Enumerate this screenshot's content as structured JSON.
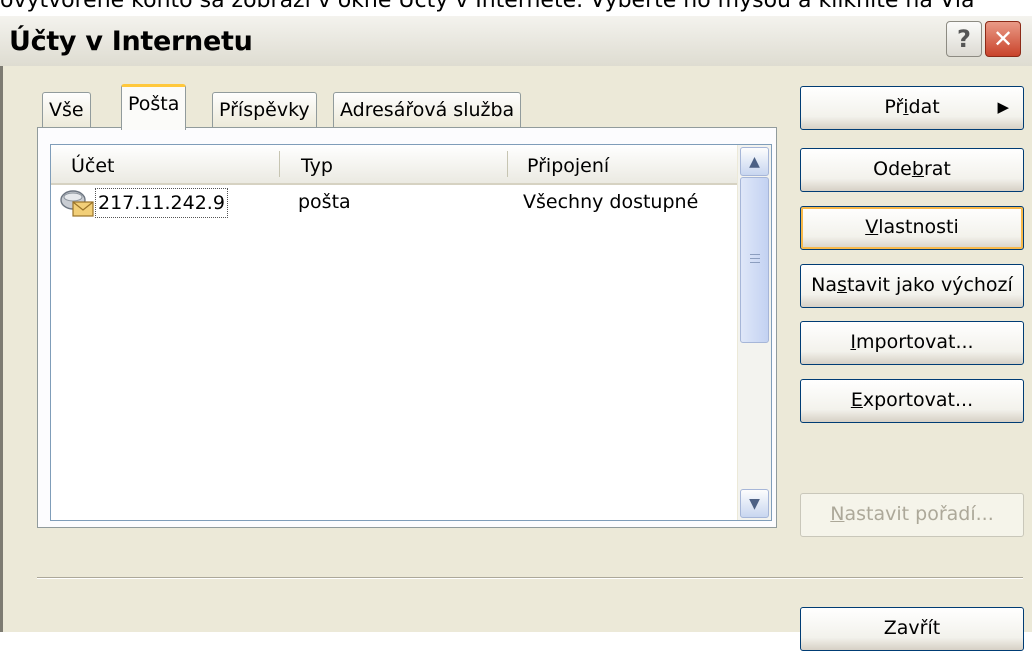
{
  "caption": "ovytvorené konto sa zobrazí v okne Účty v Internete. Vyberte ho myšou a kliknite na Vla",
  "window": {
    "title": "Účty v Internetu",
    "help_glyph": "?",
    "close_glyph": "✕"
  },
  "tabs": [
    {
      "label": "Vše",
      "active": false
    },
    {
      "label": "Pošta",
      "active": true
    },
    {
      "label": "Příspěvky",
      "active": false
    },
    {
      "label": "Adresářová služba",
      "active": false
    }
  ],
  "list": {
    "columns": [
      "Účet",
      "Typ",
      "Připojení"
    ],
    "rows": [
      {
        "icon": "mail-account-icon",
        "account": "217.11.242.9",
        "type": "pošta",
        "connection": "Všechny dostupné"
      }
    ]
  },
  "buttons": {
    "add": {
      "pre": "Př",
      "key": "i",
      "post": "dat"
    },
    "remove": {
      "pre": "Ode",
      "key": "b",
      "post": "rat"
    },
    "properties": {
      "pre": "",
      "key": "V",
      "post": "lastnosti"
    },
    "set_default": {
      "pre": "Na",
      "key": "s",
      "post": "tavit jako výchozí"
    },
    "import": {
      "pre": "",
      "key": "I",
      "post": "mportovat..."
    },
    "export": {
      "pre": "",
      "key": "E",
      "post": "xportovat..."
    },
    "set_order": {
      "pre": "",
      "key": "N",
      "post": "astavit pořadí..."
    },
    "close": {
      "label": "Zavřít"
    }
  },
  "icons": {
    "add_arrow": "▶",
    "scroll_up": "▲",
    "scroll_down": "▼"
  },
  "colors": {
    "dialog_bg": "#ece9d8",
    "focus_ring": "#f8b94a",
    "button_border": "#003c74",
    "close_red": "#c9432b"
  }
}
